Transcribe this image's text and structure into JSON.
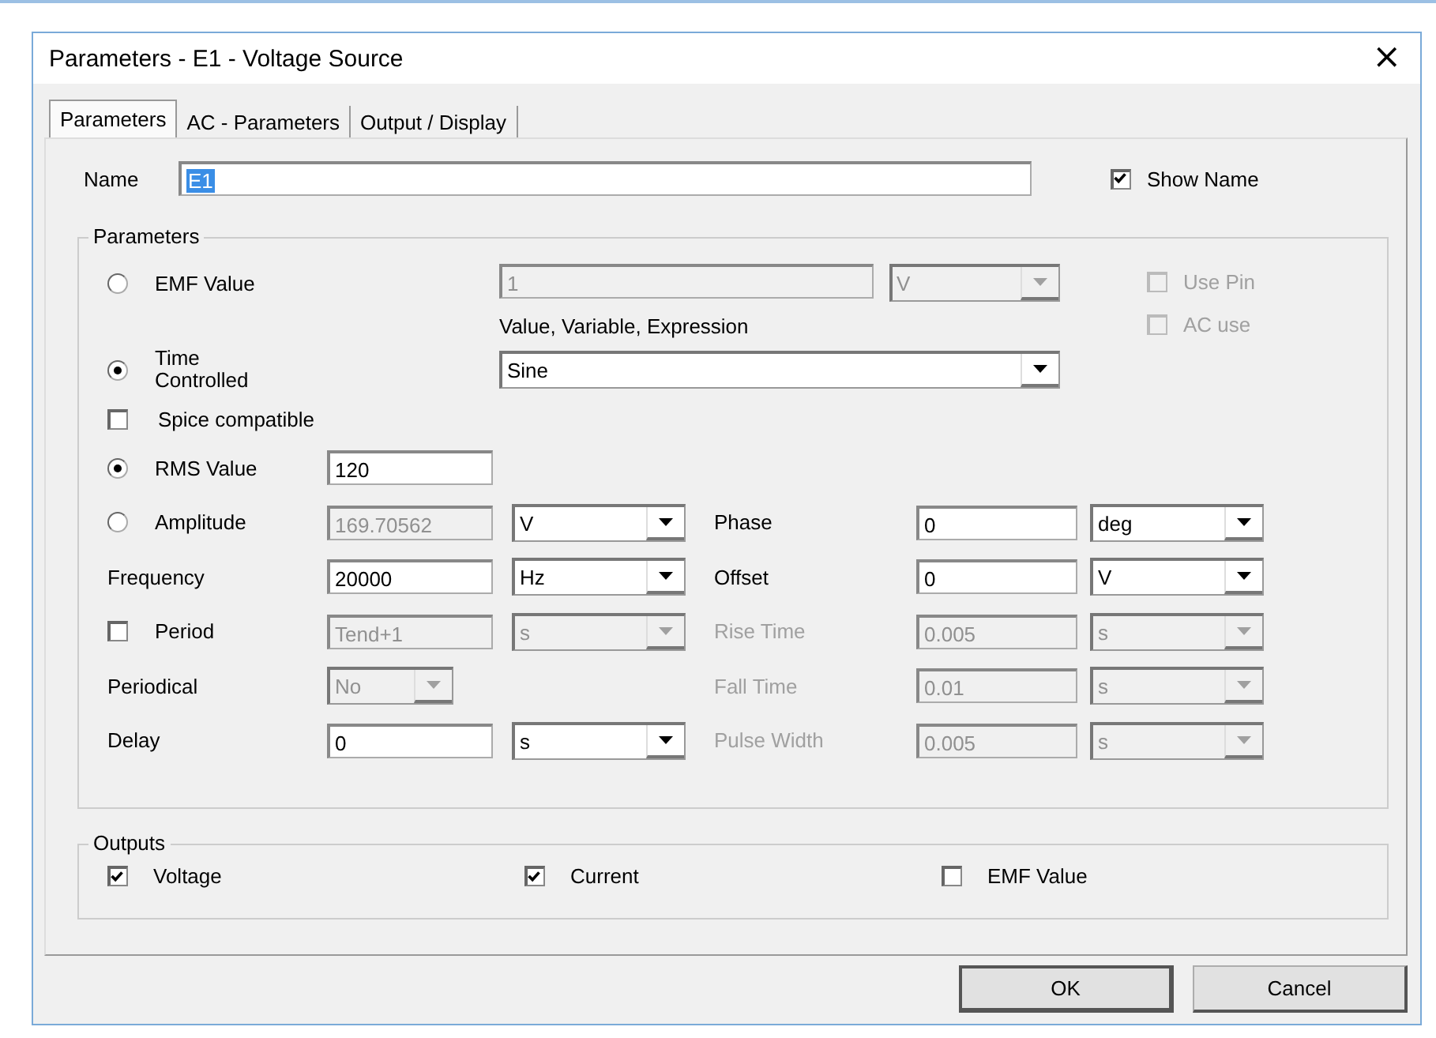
{
  "window": {
    "title": "Parameters - E1 - Voltage Source",
    "close": "×"
  },
  "tabs": [
    {
      "label": "Parameters",
      "selected": true
    },
    {
      "label": "AC - Parameters",
      "selected": false
    },
    {
      "label": "Output / Display",
      "selected": false
    }
  ],
  "name": {
    "label": "Name",
    "value": "E1",
    "highlighted": true
  },
  "show_name": {
    "label": "Show Name",
    "checked": true
  },
  "parameters": {
    "title": "Parameters",
    "emf": {
      "label": "EMF Value",
      "selected": false,
      "value": "1",
      "unit": "V",
      "disabled": true,
      "hint": "Value, Variable, Expression"
    },
    "side_options": [
      {
        "label": "Use Pin",
        "checked": false,
        "disabled": true
      },
      {
        "label": "AC use",
        "checked": false,
        "disabled": true
      }
    ],
    "time_controlled": {
      "label": "Time Controlled",
      "selected": true,
      "value": "Sine"
    },
    "spice_compatible": {
      "label": "Spice compatible",
      "checked": false
    },
    "rows": [
      {
        "left": {
          "kind": "radio",
          "label": "RMS Value",
          "selected": true,
          "field": {
            "kind": "input",
            "value": "120",
            "disabled": false
          }
        }
      },
      {
        "left": {
          "kind": "radio",
          "label": "Amplitude",
          "selected": false,
          "field": {
            "kind": "input",
            "value": "169.70562",
            "disabled": true
          },
          "unit": {
            "value": "V",
            "disabled": false
          }
        },
        "right": {
          "label": "Phase",
          "disabled": false,
          "field": {
            "value": "0",
            "disabled": false
          },
          "unit": {
            "value": "deg",
            "disabled": false
          }
        }
      },
      {
        "left": {
          "kind": "text",
          "label": "Frequency",
          "field": {
            "kind": "input",
            "value": "20000",
            "disabled": false
          },
          "unit": {
            "value": "Hz",
            "disabled": false
          }
        },
        "right": {
          "label": "Offset",
          "disabled": false,
          "field": {
            "value": "0",
            "disabled": false
          },
          "unit": {
            "value": "V",
            "disabled": false
          }
        }
      },
      {
        "left": {
          "kind": "checkbox",
          "label": "Period",
          "checked": false,
          "field": {
            "kind": "input",
            "value": "Tend+1",
            "disabled": true
          },
          "unit": {
            "value": "s",
            "disabled": true
          }
        },
        "right": {
          "label": "Rise Time",
          "disabled": true,
          "field": {
            "value": "0.005",
            "disabled": true
          },
          "unit": {
            "value": "s",
            "disabled": true
          }
        }
      },
      {
        "left": {
          "kind": "text",
          "label": "Periodical",
          "field": {
            "kind": "select",
            "value": "No",
            "disabled": true
          }
        },
        "right": {
          "label": "Fall Time",
          "disabled": true,
          "field": {
            "value": "0.01",
            "disabled": true
          },
          "unit": {
            "value": "s",
            "disabled": true
          }
        }
      },
      {
        "left": {
          "kind": "text",
          "label": "Delay",
          "field": {
            "kind": "input",
            "value": "0",
            "disabled": false
          },
          "unit": {
            "value": "s",
            "disabled": false
          }
        },
        "right": {
          "label": "Pulse Width",
          "disabled": true,
          "field": {
            "value": "0.005",
            "disabled": true
          },
          "unit": {
            "value": "s",
            "disabled": true
          }
        }
      }
    ]
  },
  "outputs": {
    "title": "Outputs",
    "items": [
      {
        "label": "Voltage",
        "checked": true
      },
      {
        "label": "Current",
        "checked": true
      },
      {
        "label": "EMF Value",
        "checked": false
      }
    ]
  },
  "buttons": [
    {
      "label": "OK",
      "default": true
    },
    {
      "label": "Cancel",
      "default": false
    }
  ]
}
